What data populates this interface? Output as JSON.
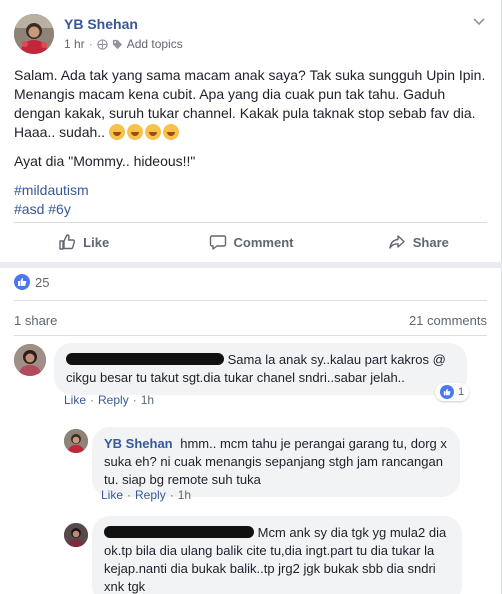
{
  "post": {
    "author": "YB Shehan",
    "time": "1 hr",
    "separator": "·",
    "add_topics": "Add topics",
    "text_lines": [
      "Salam. Ada tak yang sama macam anak saya? Tak suka sungguh Upin Ipin. Menangis macam kena cubit. Apa yang dia cuak pun tak tahu. Gaduh dengan kakak, suruh tukar channel. Kakak pula taknak stop sebab fav dia. Haaa.. sudah.."
    ],
    "emoji_count": 4,
    "quote": "Ayat dia \"Mommy.. hideous!!\"",
    "hashtags": [
      "#mildautism",
      "#asd #6y"
    ]
  },
  "actions": {
    "like": "Like",
    "comment": "Comment",
    "share": "Share"
  },
  "stats": {
    "reactions": "25",
    "shares": "1 share",
    "comments": "21 comments"
  },
  "comments": [
    {
      "text": "Sama la anak sy..kalau part kakros @ cikgu besar tu takut sgt.dia tukar chanel sndri..sabar jelah..",
      "like": "Like",
      "reply": "Reply",
      "time": "1h",
      "reactions": "1"
    },
    {
      "author": "YB Shehan",
      "text": "hmm.. mcm tahu je perangai garang tu, dorg x suka eh? ni cuak menangis sepanjang stgh jam rancangan tu. siap bg remote suh tuka",
      "like": "Like",
      "reply": "Reply",
      "time": "1h"
    },
    {
      "text": "Mcm ank sy dia tgk yg mula2 dia ok.tp bila dia ulang balik cite tu,dia ingt.part tu dia tukar la kejap.nanti dia bukak balik..tp jrg2 jgk bukak sbb dia sndri xnk tgk"
    }
  ],
  "colors": {
    "link_blue": "#365899",
    "like_blue": "#4b78f0",
    "meta_gray": "#606770"
  }
}
